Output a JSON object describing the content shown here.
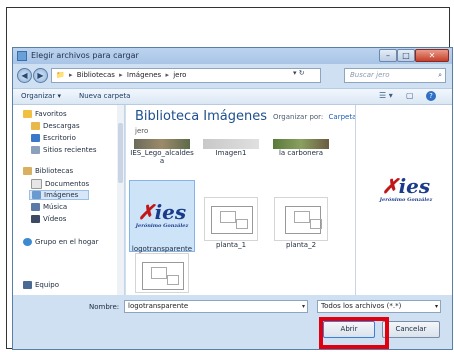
{
  "window": {
    "title": "Elegir archivos para cargar",
    "min_glyph": "–",
    "max_glyph": "□",
    "close_glyph": "✕"
  },
  "address": {
    "back_glyph": "◀",
    "forward_glyph": "▶",
    "crumbs": [
      "Bibliotecas",
      "Imágenes",
      "jero"
    ],
    "sep": "▸",
    "refresh_glyph": "▾  ↻",
    "search_placeholder": "Buscar jero",
    "search_glyph": "⌕"
  },
  "toolbar": {
    "organize": "Organizar ▾",
    "new_folder": "Nueva carpeta",
    "view_glyph": "☰ ▾",
    "pane_glyph": "▢",
    "help_glyph": "?"
  },
  "sidebar": {
    "favorites": "Favoritos",
    "descargas": "Descargas",
    "escritorio": "Escritorio",
    "recientes": "Sitios recientes",
    "libraries": "Bibliotecas",
    "documentos": "Documentos",
    "imagenes": "Imágenes",
    "musica": "Música",
    "videos": "Vídeos",
    "homegroup": "Grupo en el hogar",
    "equipo": "Equipo"
  },
  "main": {
    "title": "Biblioteca Imágenes",
    "subtitle": "jero",
    "arrange_label": "Organizar por:",
    "arrange_value": "Carpeta ▾",
    "files_row1": [
      "IES_Lego_alcaldes a",
      "Imagen1",
      "la carbonera"
    ],
    "files_row2": [
      "logotransparente",
      "planta_1",
      "planta_2"
    ]
  },
  "logo": {
    "text": "ies",
    "x": "✗",
    "sub": "Jerónimo González"
  },
  "footer": {
    "filename_label": "Nombre:",
    "filename_value": "logotransparente",
    "filter_value": "Todos los archivos (*.*)",
    "open_label": "Abrir",
    "cancel_label": "Cancelar",
    "dropdown_glyph": "▾"
  },
  "colors": {
    "highlight": "#e00010",
    "logo_blue": "#1a3a8a",
    "logo_red": "#c01818"
  }
}
